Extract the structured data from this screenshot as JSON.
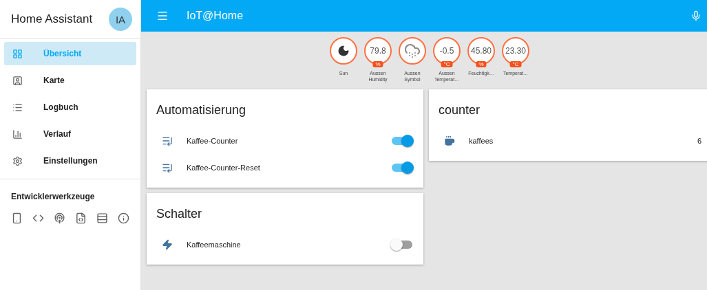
{
  "sidebar": {
    "title": "Home Assistant",
    "avatar": "IA",
    "items": [
      {
        "label": "Übersicht",
        "kind": "grid",
        "selected": true
      },
      {
        "label": "Karte",
        "kind": "map",
        "selected": false
      },
      {
        "label": "Logbuch",
        "kind": "list",
        "selected": false
      },
      {
        "label": "Verlauf",
        "kind": "chart",
        "selected": false
      },
      {
        "label": "Einstellungen",
        "kind": "settings",
        "selected": false
      }
    ],
    "section_title": "Entwicklerwerkzeuge"
  },
  "header": {
    "title": "IoT@Home"
  },
  "badges": [
    {
      "kind": "moon",
      "label": "Sun"
    },
    {
      "kind": "value",
      "value": "79.8",
      "unit": "%",
      "label": "Aussen Humidity"
    },
    {
      "kind": "weather",
      "label": "Aussen Symbol"
    },
    {
      "kind": "value",
      "value": "-0.5",
      "unit": "°C",
      "label": "Aussen Temperat…"
    },
    {
      "kind": "value",
      "value": "45.80",
      "unit": "%",
      "label": "Feuchtigk…"
    },
    {
      "kind": "value",
      "value": "23.30",
      "unit": "°C",
      "label": "Temperat…"
    }
  ],
  "cards": [
    {
      "title": "Automatisierung",
      "rows": [
        {
          "kind": "automation",
          "name": "Kaffee-Counter",
          "on": true
        },
        {
          "kind": "automation",
          "name": "Kaffee-Counter-Reset",
          "on": true
        }
      ]
    },
    {
      "title": "Schalter",
      "rows": [
        {
          "kind": "switch",
          "name": "Kaffeemaschine",
          "on": false
        }
      ]
    },
    {
      "title": "counter",
      "rows": [
        {
          "kind": "counter",
          "name": "kaffees",
          "value": "6"
        }
      ]
    }
  ]
}
